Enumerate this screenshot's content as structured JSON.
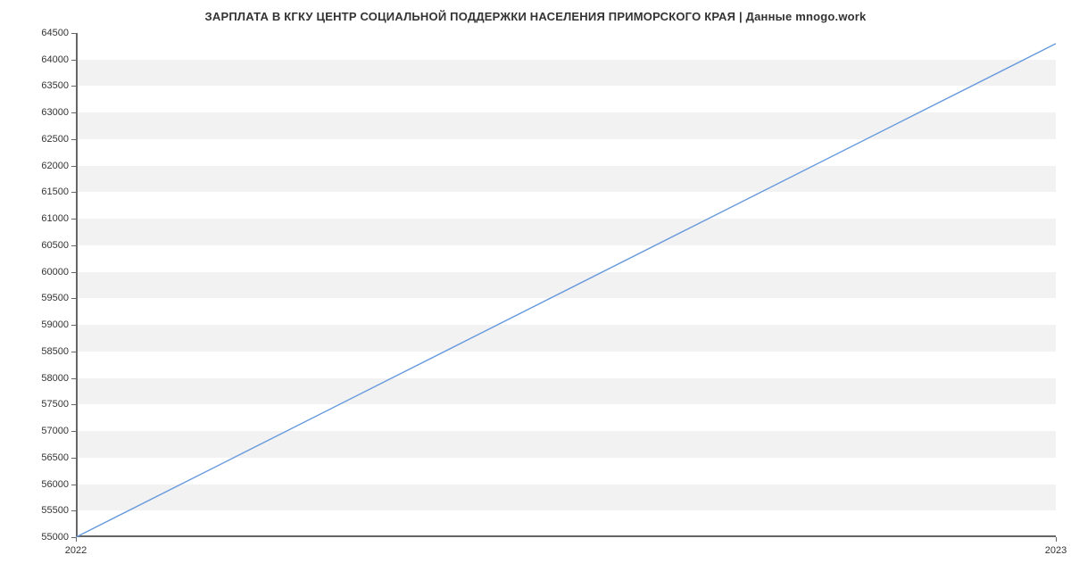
{
  "chart_data": {
    "type": "line",
    "title": "ЗАРПЛАТА В КГКУ ЦЕНТР СОЦИАЛЬНОЙ ПОДДЕРЖКИ НАСЕЛЕНИЯ ПРИМОРСКОГО КРАЯ | Данные mnogo.work",
    "x": [
      2022,
      2023
    ],
    "values": [
      55000,
      64300
    ],
    "xlabel": "",
    "ylabel": "",
    "xlim": [
      2022,
      2023
    ],
    "ylim": [
      55000,
      64500
    ],
    "y_ticks": [
      55000,
      55500,
      56000,
      56500,
      57000,
      57500,
      58000,
      58500,
      59000,
      59500,
      60000,
      60500,
      61000,
      61500,
      62000,
      62500,
      63000,
      63500,
      64000,
      64500
    ],
    "x_ticks": [
      2022,
      2023
    ],
    "line_color": "#6699dd"
  }
}
